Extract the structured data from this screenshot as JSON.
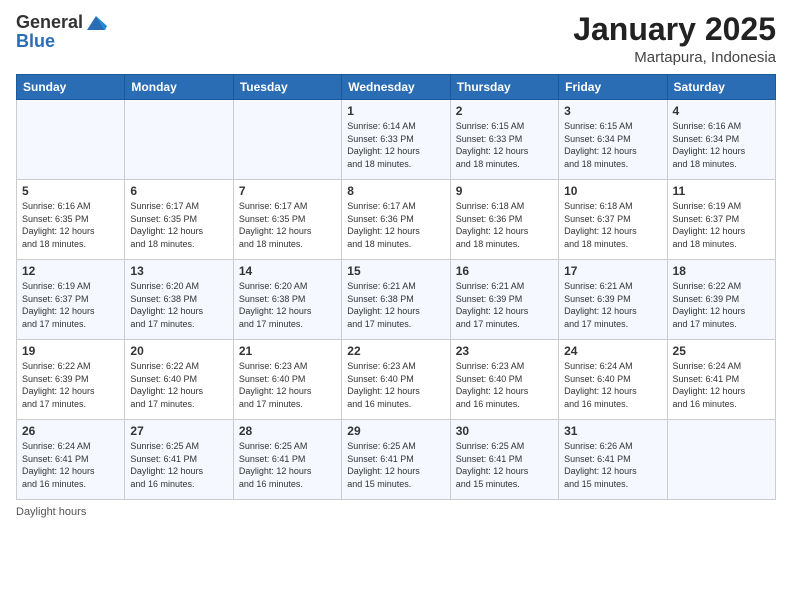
{
  "header": {
    "logo_general": "General",
    "logo_blue": "Blue",
    "title": "January 2025",
    "location": "Martapura, Indonesia"
  },
  "days_of_week": [
    "Sunday",
    "Monday",
    "Tuesday",
    "Wednesday",
    "Thursday",
    "Friday",
    "Saturday"
  ],
  "footer_label": "Daylight hours",
  "weeks": [
    [
      {
        "day": "",
        "info": ""
      },
      {
        "day": "",
        "info": ""
      },
      {
        "day": "",
        "info": ""
      },
      {
        "day": "1",
        "info": "Sunrise: 6:14 AM\nSunset: 6:33 PM\nDaylight: 12 hours\nand 18 minutes."
      },
      {
        "day": "2",
        "info": "Sunrise: 6:15 AM\nSunset: 6:33 PM\nDaylight: 12 hours\nand 18 minutes."
      },
      {
        "day": "3",
        "info": "Sunrise: 6:15 AM\nSunset: 6:34 PM\nDaylight: 12 hours\nand 18 minutes."
      },
      {
        "day": "4",
        "info": "Sunrise: 6:16 AM\nSunset: 6:34 PM\nDaylight: 12 hours\nand 18 minutes."
      }
    ],
    [
      {
        "day": "5",
        "info": "Sunrise: 6:16 AM\nSunset: 6:35 PM\nDaylight: 12 hours\nand 18 minutes."
      },
      {
        "day": "6",
        "info": "Sunrise: 6:17 AM\nSunset: 6:35 PM\nDaylight: 12 hours\nand 18 minutes."
      },
      {
        "day": "7",
        "info": "Sunrise: 6:17 AM\nSunset: 6:35 PM\nDaylight: 12 hours\nand 18 minutes."
      },
      {
        "day": "8",
        "info": "Sunrise: 6:17 AM\nSunset: 6:36 PM\nDaylight: 12 hours\nand 18 minutes."
      },
      {
        "day": "9",
        "info": "Sunrise: 6:18 AM\nSunset: 6:36 PM\nDaylight: 12 hours\nand 18 minutes."
      },
      {
        "day": "10",
        "info": "Sunrise: 6:18 AM\nSunset: 6:37 PM\nDaylight: 12 hours\nand 18 minutes."
      },
      {
        "day": "11",
        "info": "Sunrise: 6:19 AM\nSunset: 6:37 PM\nDaylight: 12 hours\nand 18 minutes."
      }
    ],
    [
      {
        "day": "12",
        "info": "Sunrise: 6:19 AM\nSunset: 6:37 PM\nDaylight: 12 hours\nand 17 minutes."
      },
      {
        "day": "13",
        "info": "Sunrise: 6:20 AM\nSunset: 6:38 PM\nDaylight: 12 hours\nand 17 minutes."
      },
      {
        "day": "14",
        "info": "Sunrise: 6:20 AM\nSunset: 6:38 PM\nDaylight: 12 hours\nand 17 minutes."
      },
      {
        "day": "15",
        "info": "Sunrise: 6:21 AM\nSunset: 6:38 PM\nDaylight: 12 hours\nand 17 minutes."
      },
      {
        "day": "16",
        "info": "Sunrise: 6:21 AM\nSunset: 6:39 PM\nDaylight: 12 hours\nand 17 minutes."
      },
      {
        "day": "17",
        "info": "Sunrise: 6:21 AM\nSunset: 6:39 PM\nDaylight: 12 hours\nand 17 minutes."
      },
      {
        "day": "18",
        "info": "Sunrise: 6:22 AM\nSunset: 6:39 PM\nDaylight: 12 hours\nand 17 minutes."
      }
    ],
    [
      {
        "day": "19",
        "info": "Sunrise: 6:22 AM\nSunset: 6:39 PM\nDaylight: 12 hours\nand 17 minutes."
      },
      {
        "day": "20",
        "info": "Sunrise: 6:22 AM\nSunset: 6:40 PM\nDaylight: 12 hours\nand 17 minutes."
      },
      {
        "day": "21",
        "info": "Sunrise: 6:23 AM\nSunset: 6:40 PM\nDaylight: 12 hours\nand 17 minutes."
      },
      {
        "day": "22",
        "info": "Sunrise: 6:23 AM\nSunset: 6:40 PM\nDaylight: 12 hours\nand 16 minutes."
      },
      {
        "day": "23",
        "info": "Sunrise: 6:23 AM\nSunset: 6:40 PM\nDaylight: 12 hours\nand 16 minutes."
      },
      {
        "day": "24",
        "info": "Sunrise: 6:24 AM\nSunset: 6:40 PM\nDaylight: 12 hours\nand 16 minutes."
      },
      {
        "day": "25",
        "info": "Sunrise: 6:24 AM\nSunset: 6:41 PM\nDaylight: 12 hours\nand 16 minutes."
      }
    ],
    [
      {
        "day": "26",
        "info": "Sunrise: 6:24 AM\nSunset: 6:41 PM\nDaylight: 12 hours\nand 16 minutes."
      },
      {
        "day": "27",
        "info": "Sunrise: 6:25 AM\nSunset: 6:41 PM\nDaylight: 12 hours\nand 16 minutes."
      },
      {
        "day": "28",
        "info": "Sunrise: 6:25 AM\nSunset: 6:41 PM\nDaylight: 12 hours\nand 16 minutes."
      },
      {
        "day": "29",
        "info": "Sunrise: 6:25 AM\nSunset: 6:41 PM\nDaylight: 12 hours\nand 15 minutes."
      },
      {
        "day": "30",
        "info": "Sunrise: 6:25 AM\nSunset: 6:41 PM\nDaylight: 12 hours\nand 15 minutes."
      },
      {
        "day": "31",
        "info": "Sunrise: 6:26 AM\nSunset: 6:41 PM\nDaylight: 12 hours\nand 15 minutes."
      },
      {
        "day": "",
        "info": ""
      }
    ]
  ]
}
